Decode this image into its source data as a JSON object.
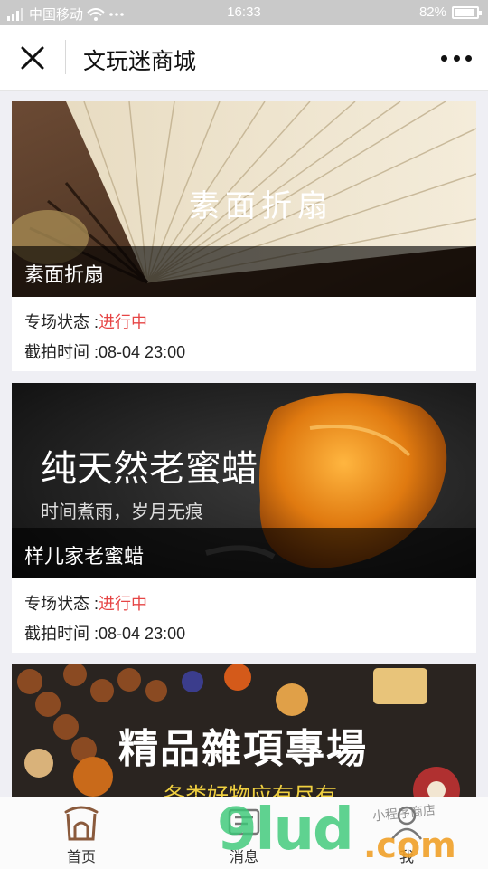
{
  "status_bar": {
    "carrier": "中国移动",
    "time": "16:33",
    "battery": "82%"
  },
  "nav": {
    "title": "文玩迷商城"
  },
  "cards": [
    {
      "banner_text": "素面折扇",
      "caption": "素面折扇",
      "status_label": "专场状态 :",
      "status_value": "进行中",
      "deadline_label": "截拍时间 :",
      "deadline_value": "08-04 23:00"
    },
    {
      "banner_text": "纯天然老蜜蜡",
      "banner_subtext": "时间煮雨，岁月无痕",
      "caption": "样儿家老蜜蜡",
      "status_label": "专场状态 :",
      "status_value": "进行中",
      "deadline_label": "截拍时间 :",
      "deadline_value": "08-04 23:00"
    },
    {
      "banner_text": "精品雜項專場",
      "banner_subtext": "各类好物应有尽有"
    }
  ],
  "tabs": [
    {
      "label": "首页"
    },
    {
      "label": "消息"
    },
    {
      "label": "我"
    }
  ],
  "watermark": {
    "text": "9lud",
    "suffix": ".com",
    "sub": "小程序商店"
  },
  "colors": {
    "status_active": "#e64545",
    "tab_home_icon": "#8a5a3c"
  }
}
